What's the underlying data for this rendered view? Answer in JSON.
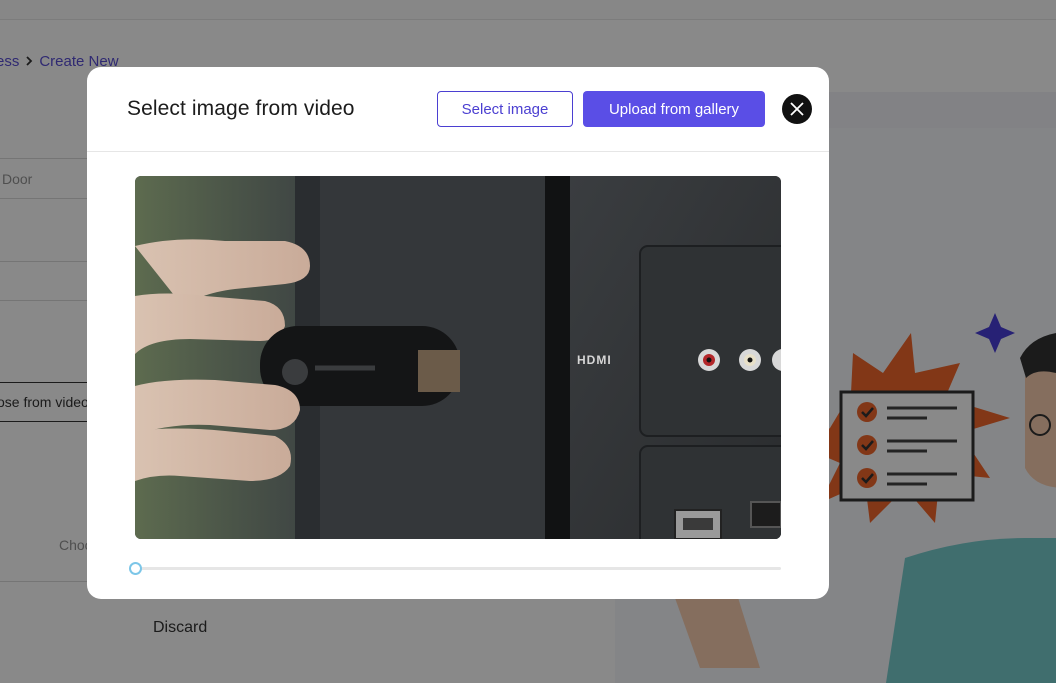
{
  "background": {
    "breadcrumb": {
      "previous": "ess",
      "current": "Create New"
    },
    "form": {
      "field_value": "Door",
      "choose_from_video_label": "ose from video",
      "choose_file_label": "Choo",
      "discard_label": "Discard"
    }
  },
  "modal": {
    "title": "Select image from video",
    "select_image_label": "Select image",
    "upload_label": "Upload from gallery",
    "video": {
      "device_label": "HDMI",
      "scrub_position": 0
    }
  },
  "colors": {
    "accent": "#5a4ee6",
    "accent_text": "#4b3fd1",
    "overlay": "rgba(20,20,20,0.5)",
    "scrubber_thumb": "#7cc6e8"
  }
}
